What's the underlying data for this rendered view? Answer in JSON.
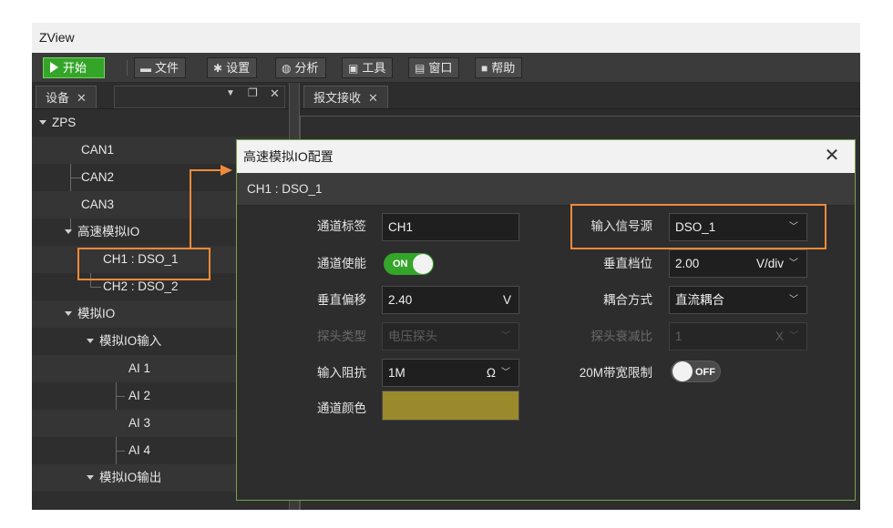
{
  "app": {
    "title": "ZView"
  },
  "toolbar": {
    "start": "开始",
    "items": [
      {
        "label": "文件",
        "icon": "folder-icon"
      },
      {
        "label": "设置",
        "icon": "gear-icon"
      },
      {
        "label": "分析",
        "icon": "analysis-icon"
      },
      {
        "label": "工具",
        "icon": "toolbox-icon"
      },
      {
        "label": "窗口",
        "icon": "window-icon"
      },
      {
        "label": "帮助",
        "icon": "help-icon"
      }
    ]
  },
  "panels": {
    "device_tab": "设备",
    "message_tab": "报文接收"
  },
  "tree": {
    "root": "ZPS",
    "can1": "CAN1",
    "can2": "CAN2",
    "can3": "CAN3",
    "hs_analog": "高速模拟IO",
    "ch1": "CH1 : DSO_1",
    "ch2": "CH2 : DSO_2",
    "analog": "模拟IO",
    "analog_in": "模拟IO输入",
    "ai1": "AI 1",
    "ai2": "AI 2",
    "ai3": "AI 3",
    "ai4": "AI 4",
    "analog_out": "模拟IO输出"
  },
  "dialog": {
    "title": "高速模拟IO配置",
    "subtitle": "CH1 : DSO_1",
    "labels": {
      "channel_tag": "通道标签",
      "channel_enable": "通道使能",
      "vertical_offset": "垂直偏移",
      "probe_type": "探头类型",
      "input_impedance": "输入阻抗",
      "channel_color": "通道颜色",
      "input_source": "输入信号源",
      "vertical_scale": "垂直档位",
      "coupling": "耦合方式",
      "probe_attenuation": "探头衰减比",
      "bw_limit": "20M带宽限制"
    },
    "values": {
      "channel_tag": "CH1",
      "channel_enable": "ON",
      "vertical_offset": "2.40",
      "vertical_offset_unit": "V",
      "probe_type": "电压探头",
      "input_impedance": "1M",
      "input_impedance_unit": "Ω",
      "input_source": "DSO_1",
      "vertical_scale": "2.00",
      "vertical_scale_unit": "V/div",
      "coupling": "直流耦合",
      "probe_attenuation": "1",
      "probe_attenuation_unit": "X",
      "bw_limit": "OFF",
      "channel_color": "#9a8a2c"
    }
  },
  "colors": {
    "accent_green": "#35a52a",
    "annotation_orange": "#f08a3a",
    "dialog_border": "#76a34a"
  }
}
